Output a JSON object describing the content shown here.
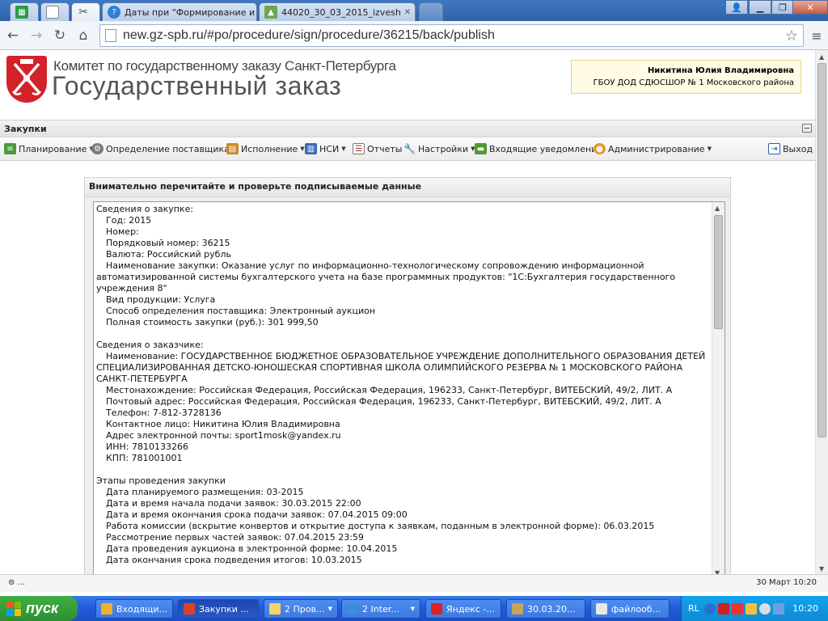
{
  "browser": {
    "tabs": [
      {
        "label": "",
        "icon": "spreadsheet-icon"
      },
      {
        "label": "",
        "icon": "blank-page-icon"
      },
      {
        "label": "",
        "icon": "tools-icon",
        "active": true
      },
      {
        "label": "Даты при \"Формирование и",
        "icon": "help-icon"
      },
      {
        "label": "44020_30_03_2015_izvesh",
        "icon": "image-icon"
      },
      {
        "label": "",
        "icon": "new-tab-icon"
      }
    ],
    "url": "new.gz-spb.ru/#po/procedure/sign/procedure/36215/back/publish"
  },
  "site": {
    "org_name": "Комитет по государственному заказу Санкт-Петербурга",
    "title": "Государственный заказ",
    "user_name": "Никитина Юлия Владимировна",
    "user_org": "ГБОУ ДОД СДЮСШОР № 1 Московского района"
  },
  "panel": {
    "title": "Закупки"
  },
  "menu": {
    "items": [
      {
        "label": "Планирование",
        "dropdown": true
      },
      {
        "label": "Определение поставщика",
        "dropdown": true
      },
      {
        "label": "Исполнение",
        "dropdown": true
      },
      {
        "label": "НСИ",
        "dropdown": true
      },
      {
        "label": "Отчеты",
        "dropdown": false
      },
      {
        "label": "Настройки",
        "dropdown": true
      },
      {
        "label": "Входящие уведомления",
        "dropdown": false
      },
      {
        "label": "Администрирование",
        "dropdown": true
      }
    ],
    "exit_label": "Выход"
  },
  "dialog": {
    "title": "Внимательно перечитайте и проверьте подписываемые данные",
    "lines": [
      {
        "text": "Сведения о закупке:",
        "indent": false
      },
      {
        "text": "Год: 2015",
        "indent": true
      },
      {
        "text": "Номер:",
        "indent": true
      },
      {
        "text": "Порядковый номер: 36215",
        "indent": true
      },
      {
        "text": "Валюта: Российский рубль",
        "indent": true
      },
      {
        "text": "Наименование закупки: Оказание услуг по информационно-технологическому сопровождению информационной автоматизированной системы бухгалтерского учета на базе программных продуктов: \"1С:Бухгалтерия государственного учреждения 8\"",
        "indent": true,
        "wrap": true
      },
      {
        "text": "Вид продукции: Услуга",
        "indent": true
      },
      {
        "text": "Способ определения поставщика: Электронный аукцион",
        "indent": true
      },
      {
        "text": "Полная стоимость закупки (руб.): 301 999,50",
        "indent": true
      },
      {
        "text": "",
        "gap": true
      },
      {
        "text": "Сведения о заказчике:",
        "indent": false
      },
      {
        "text": "Наименование: ГОСУДАРСТВЕННОЕ БЮДЖЕТНОЕ ОБРАЗОВАТЕЛЬНОЕ УЧРЕЖДЕНИЕ ДОПОЛНИТЕЛЬНОГО ОБРАЗОВАНИЯ ДЕТЕЙ СПЕЦИАЛИЗИРОВАННАЯ ДЕТСКО-ЮНОШЕСКАЯ СПОРТИВНАЯ ШКОЛА ОЛИМПИЙСКОГО РЕЗЕРВА № 1 МОСКОВСКОГО РАЙОНА САНКТ-ПЕТЕРБУРГА",
        "indent": true,
        "wrap": true
      },
      {
        "text": "Местонахождение: Российская Федерация, Российская Федерация, 196233, Санкт-Петербург, ВИТЕБСКИЙ, 49/2, ЛИТ. А",
        "indent": true
      },
      {
        "text": "Почтовый адрес: Российская Федерация, Российская Федерация, 196233, Санкт-Петербург, ВИТЕБСКИЙ, 49/2, ЛИТ. А",
        "indent": true
      },
      {
        "text": "Телефон: 7-812-3728136",
        "indent": true
      },
      {
        "text": "Контактное лицо: Никитина Юлия Владимировна",
        "indent": true
      },
      {
        "text": "Адрес электронной почты: sport1mosk@yandex.ru",
        "indent": true
      },
      {
        "text": "ИНН: 7810133266",
        "indent": true
      },
      {
        "text": "КПП: 781001001",
        "indent": true
      },
      {
        "text": "",
        "gap": true
      },
      {
        "text": "Этапы проведения закупки",
        "indent": false
      },
      {
        "text": "Дата планируемого размещения: 03-2015",
        "indent": true
      },
      {
        "text": "Дата и время начала подачи заявок: 30.03.2015 22:00",
        "indent": true
      },
      {
        "text": "Дата и время окончания срока подачи заявок: 07.04.2015 09:00",
        "indent": true
      },
      {
        "text": "Работа комиссии (вскрытие конвертов и открытие доступа к заявкам, поданным в электронной форме): 06.03.2015",
        "indent": true
      },
      {
        "text": "Рассмотрение первых частей заявок: 07.04.2015 23:59",
        "indent": true
      },
      {
        "text": "Дата проведения аукциона в электронной форме: 10.04.2015",
        "indent": true
      },
      {
        "text": "Дата окончания срока подведения итогов: 10.03.2015",
        "indent": true
      }
    ]
  },
  "statusbar": {
    "left": "⊚ ...",
    "right": "30 Март 10:20"
  },
  "taskbar": {
    "start_label": "пуск",
    "items": [
      {
        "label": "Входящи...",
        "icon_color": "#f0b030"
      },
      {
        "label": "Закупки ...",
        "icon_color": "#d9432c",
        "active": true
      },
      {
        "label": "2 Пров...",
        "icon_color": "#f4d36b",
        "dropdown": true
      },
      {
        "label": "2 Inter...",
        "icon_color": "#3b8be0",
        "dropdown": true
      },
      {
        "label": "Яндекс -...",
        "icon_color": "#d22"
      },
      {
        "label": "30.03.20...",
        "icon_color": "#c9a45a"
      },
      {
        "label": "файлооб...",
        "icon_color": "#e8e8e8"
      }
    ],
    "lang": "RL",
    "clock": "10:20"
  }
}
